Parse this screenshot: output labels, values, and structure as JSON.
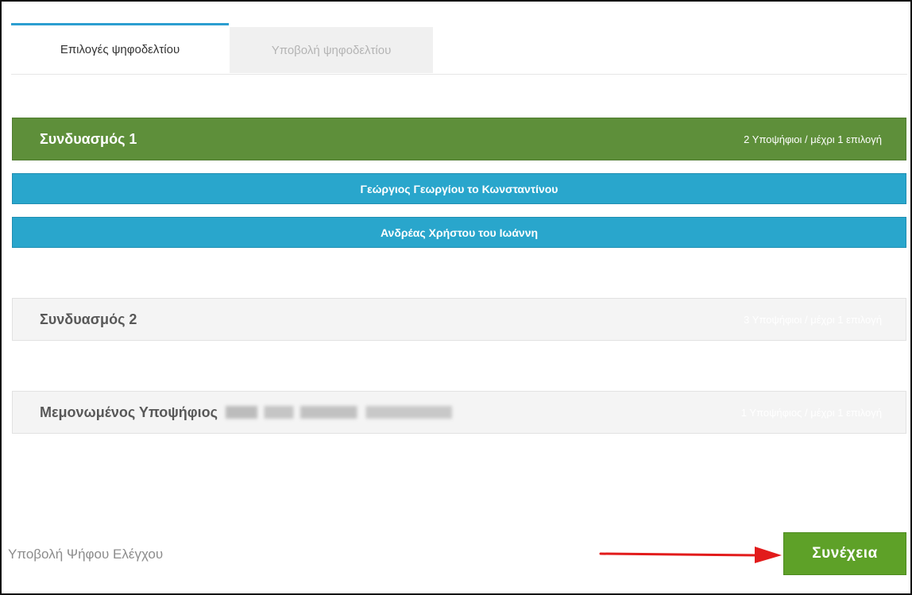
{
  "tabs": [
    {
      "label": "Επιλογές ψηφοδελτίου",
      "active": true
    },
    {
      "label": "Υποβολή ψηφοδελτίου",
      "active": false
    }
  ],
  "coalitions": [
    {
      "title": "Συνδυασμός 1",
      "meta": "2 Υποψήφιοι / μέχρι 1 επιλογή",
      "expanded": true,
      "candidates": [
        {
          "name": "Γεώργιος Γεωργίου το Κωνσταντίνου"
        },
        {
          "name": "Ανδρέας Χρήστου του Ιωάννη"
        }
      ]
    },
    {
      "title": "Συνδυασμός 2",
      "meta": "3 Υποψήφιοι / μέχρι 1 επιλογή",
      "expanded": false
    },
    {
      "title": "Μεμονωμένος Υποψήφιος",
      "meta": "1 Υποψήφιος / μέχρι 1 επιλογή",
      "expanded": false
    }
  ],
  "footer": {
    "test_vote_link": "Υποβολή Ψήφου Ελέγχου",
    "continue_label": "Συνέχεια"
  },
  "colors": {
    "tab_accent": "#2c9ed0",
    "coalition_active": "#5e8f3a",
    "candidate": "#29a6cc",
    "continue": "#5ea128",
    "arrow": "#e21b1b"
  }
}
